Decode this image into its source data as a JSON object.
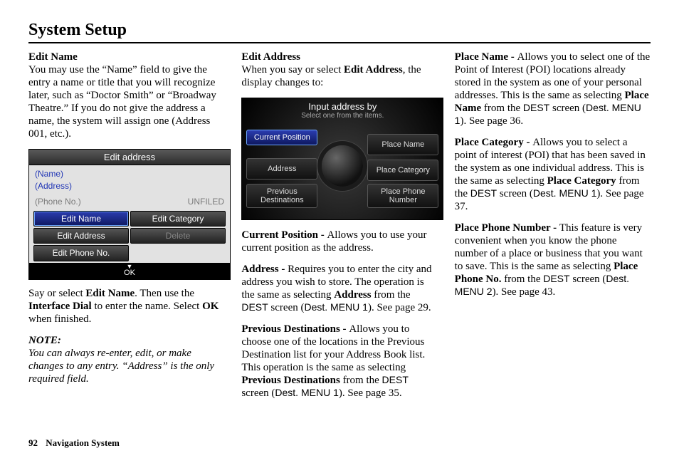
{
  "pageTitle": "System Setup",
  "footer": {
    "page": "92",
    "section": "Navigation System"
  },
  "col1": {
    "h": "Edit Name",
    "p1": "You may use the “Name” field to give the entry a name or title that you will recognize later, such as “Doctor Smith” or “Broadway Theatre.” If you do not give the address a name, the system will assign one (Address 001, etc.).",
    "afterShot_a": "Say or select ",
    "afterShot_b": "Edit Name",
    "afterShot_c": ". Then use the ",
    "afterShot_d": "Interface Dial",
    "afterShot_e": " to enter the name. Select ",
    "afterShot_f": "OK",
    "afterShot_g": " when finished.",
    "noteLabel": "NOTE:",
    "noteBody": "You can always re-enter, edit, or make changes to any entry. “Address” is the only required field."
  },
  "shot1": {
    "title": "Edit address",
    "name": "(Name)",
    "address": "(Address)",
    "phone": "(Phone No.)",
    "unfiled": "UNFILED",
    "editName": "Edit Name",
    "editCategory": "Edit Category",
    "editAddress": "Edit Address",
    "delete": "Delete",
    "editPhone": "Edit Phone No.",
    "ok": "OK"
  },
  "col2": {
    "h": "Edit Address",
    "intro_a": "When you say or select ",
    "intro_b": "Edit Address",
    "intro_c": ", the display changes to:",
    "cp_h": "Current Position - ",
    "cp_t": "Allows you to use your current position as the address.",
    "ad_h": "Address - ",
    "ad_t1": "Requires you to enter the city and address you wish to store. The operation is the same as selecting ",
    "ad_b": "Address",
    "ad_t2": " from the ",
    "ad_dest": "DEST",
    "ad_t3": " screen (",
    "ad_menu": "Dest. MENU 1",
    "ad_t4": "). See page 29.",
    "pd_h": "Previous Destinations - ",
    "pd_t1": "Allows you to choose one of the locations in the Previous Destination list for your Address Book list. This operation is the same as selecting ",
    "pd_b": "Previous Destinations",
    "pd_t2": " from the ",
    "pd_dest": "DEST",
    "pd_t3": " screen (",
    "pd_menu": "Dest. MENU 1",
    "pd_t4": "). See page 35."
  },
  "shot2": {
    "title": "Input address by",
    "subtitle": "Select one from the items.",
    "currentPosition": "Current Position",
    "address": "Address",
    "prevDest": "Previous Destinations",
    "placeName": "Place Name",
    "placeCategory": "Place Category",
    "placePhone": "Place Phone Number"
  },
  "col3": {
    "pn_h": "Place Name - ",
    "pn_t1": "Allows you to select one of the Point of Interest (POI) locations already stored in the system as one of your personal addresses. This is the same as selecting ",
    "pn_b": "Place Name",
    "pn_t2": " from the ",
    "pn_dest": "DEST",
    "pn_t3": " screen (",
    "pn_menu": "Dest. MENU 1",
    "pn_t4": "). See page 36.",
    "pc_h": "Place Category - ",
    "pc_t1": "Allows you to select a point of interest (POI) that has been saved in the system as one individual address. This is the same as selecting ",
    "pc_b": "Place Category",
    "pc_t2": " from the ",
    "pc_dest": "DEST",
    "pc_t3": " screen (",
    "pc_menu": "Dest. MENU 1",
    "pc_t4": "). See page 37.",
    "pp_h": "Place Phone Number - ",
    "pp_t1": "This feature is very convenient when you know the phone number of a place or business that you want to save. This is the same as selecting ",
    "pp_b": "Place Phone No.",
    "pp_t2": " from the ",
    "pp_dest": "DEST",
    "pp_t3": " screen (",
    "pp_menu": "Dest. MENU 2",
    "pp_t4": "). See page 43."
  }
}
